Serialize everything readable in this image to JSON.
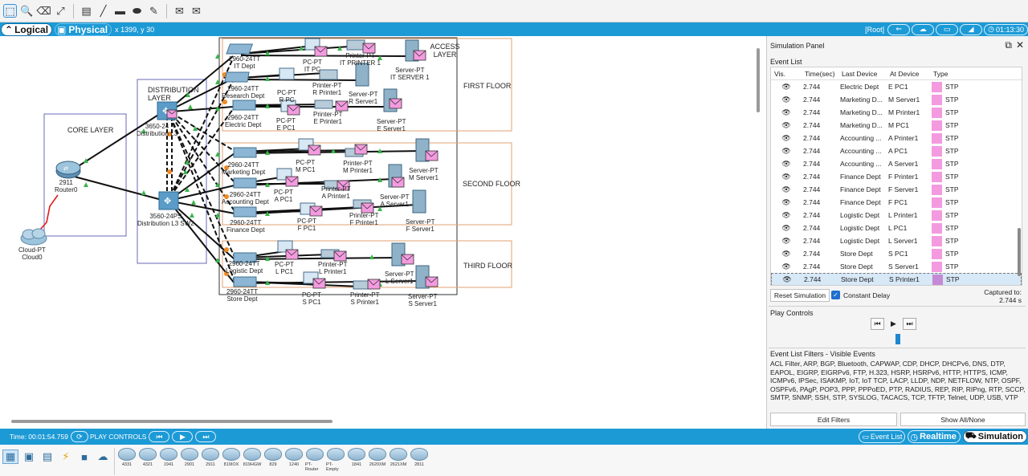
{
  "toolbar": {
    "icons": [
      "select-icon",
      "inspect-icon",
      "delete-icon",
      "resize-icon",
      "note-icon",
      "line-icon",
      "rectangle-icon",
      "ellipse-icon",
      "freeform-icon",
      "simple-pdu-icon",
      "complex-pdu-icon"
    ]
  },
  "topbar": {
    "logical_label": "Logical",
    "physical_label": "Physical",
    "coords": "x 1399, y 30",
    "root_label": "[Root]",
    "clock": "01:13:30"
  },
  "diagram": {
    "regions": {
      "core_layer": "CORE LAYER",
      "distribution_layer": "DISTRIBUTION LAYER",
      "access_layer": "ACCESS LAYER",
      "first_floor": "FIRST FLOOR",
      "second_floor": "SECOND FLOOR",
      "third_floor": "THIRD FLOOR"
    },
    "devices": {
      "cloud_model": "Cloud-PT",
      "cloud_name": "Cloud0",
      "router_model": "2911",
      "router_name": "Router0",
      "dist1_model": "3650-24",
      "dist1_name": "Distribution L3",
      "dist2_model": "3560-24PS",
      "dist2_name": "Distribution L3 SW2",
      "sw_it": "2960-24TT",
      "sw_it_name": "IT Dept",
      "sw_research": "2960-24TT",
      "sw_research_name": "Research Dept",
      "sw_electric": "2960-24TT",
      "sw_electric_name": "Electric Dept",
      "sw_marketing": "2960-24TT",
      "sw_marketing_name": "Marketing Dept",
      "sw_accounting": "2960-24TT",
      "sw_accounting_name": "Accounting Dept",
      "sw_finance": "2960-24TT",
      "sw_finance_name": "Finance Dept",
      "sw_logistic": "2960-24TT",
      "sw_logistic_name": "Logistic Dept",
      "sw_store": "2960-24TT",
      "sw_store_name": "Store Dept",
      "it_pc": "PC-PT",
      "it_pc_name": "IT PC",
      "it_printer": "Printer-PT",
      "it_printer_name": "IT PRINTER 1",
      "it_server": "Server-PT",
      "it_server_name": "IT SERVER 1",
      "r_pc": "PC-PT",
      "r_pc_name": "R PC",
      "r_printer": "Printer-PT",
      "r_printer_name": "R Printer1",
      "r_server": "Server-PT",
      "r_server_name": "R Server1",
      "e_pc": "PC-PT",
      "e_pc_name": "E PC1",
      "e_printer": "Printer-PT",
      "e_printer_name": "E Printer1",
      "e_server": "Server-PT",
      "e_server_name": "E Server1",
      "m_pc": "PC-PT",
      "m_pc_name": "M PC1",
      "m_printer": "Printer-PT",
      "m_printer_name": "M Printer1",
      "m_server": "Server-PT",
      "m_server_name": "M Server1",
      "a_pc": "PC-PT",
      "a_pc_name": "A PC1",
      "a_printer": "Printer-PT",
      "a_printer_name": "A Printer1",
      "a_server": "Server-PT",
      "a_server_name": "A Server1",
      "f_pc": "PC-PT",
      "f_pc_name": "F PC1",
      "f_printer": "Printer-PT",
      "f_printer_name": "F Printer1",
      "f_server": "Server-PT",
      "f_server_name": "F Server1",
      "l_pc": "PC-PT",
      "l_pc_name": "L PC1",
      "l_printer": "Printer-PT",
      "l_printer_name": "L Printer1",
      "l_server": "Server-PT",
      "l_server_name": "L Server1",
      "s_pc": "PC-PT",
      "s_pc_name": "S PC1",
      "s_printer": "Printer-PT",
      "s_printer_name": "S Printer1",
      "s_server": "Server-PT",
      "s_server_name": "S Server1"
    }
  },
  "sim_panel": {
    "title": "Simulation Panel",
    "event_list_label": "Event List",
    "columns": [
      "Vis.",
      "Time(sec)",
      "Last Device",
      "At Device",
      "Type"
    ],
    "events": [
      {
        "time": "2.744",
        "last": "Electric Dept",
        "at": "E PC1",
        "type": "STP"
      },
      {
        "time": "2.744",
        "last": "Marketing D...",
        "at": "M Server1",
        "type": "STP"
      },
      {
        "time": "2.744",
        "last": "Marketing D...",
        "at": "M Printer1",
        "type": "STP"
      },
      {
        "time": "2.744",
        "last": "Marketing D...",
        "at": "M PC1",
        "type": "STP"
      },
      {
        "time": "2.744",
        "last": "Accounting ...",
        "at": "A Printer1",
        "type": "STP"
      },
      {
        "time": "2.744",
        "last": "Accounting ...",
        "at": "A PC1",
        "type": "STP"
      },
      {
        "time": "2.744",
        "last": "Accounting ...",
        "at": "A Server1",
        "type": "STP"
      },
      {
        "time": "2.744",
        "last": "Finance Dept",
        "at": "F Printer1",
        "type": "STP"
      },
      {
        "time": "2.744",
        "last": "Finance Dept",
        "at": "F Server1",
        "type": "STP"
      },
      {
        "time": "2.744",
        "last": "Finance Dept",
        "at": "F PC1",
        "type": "STP"
      },
      {
        "time": "2.744",
        "last": "Logistic Dept",
        "at": "L Printer1",
        "type": "STP"
      },
      {
        "time": "2.744",
        "last": "Logistic Dept",
        "at": "L PC1",
        "type": "STP"
      },
      {
        "time": "2.744",
        "last": "Logistic Dept",
        "at": "L Server1",
        "type": "STP"
      },
      {
        "time": "2.744",
        "last": "Store Dept",
        "at": "S PC1",
        "type": "STP"
      },
      {
        "time": "2.744",
        "last": "Store Dept",
        "at": "S Server1",
        "type": "STP"
      },
      {
        "time": "2.744",
        "last": "Store Dept",
        "at": "S Printer1",
        "type": "STP",
        "selected": true
      }
    ],
    "stp_color": "#f49be0",
    "reset_label": "Reset Simulation",
    "constant_delay_label": "Constant Delay",
    "captured_label": "Captured to:",
    "captured_value": "2.744 s",
    "play_controls_label": "Play Controls",
    "filters_label": "Event List Filters - Visible Events",
    "filters_text": "ACL Filter, ARP, BGP, Bluetooth, CAPWAP, CDP, DHCP, DHCPv6, DNS, DTP, EAPOL, EIGRP, EIGRPv6, FTP, H.323, HSRP, HSRPv6, HTTP, HTTPS, ICMP, ICMPv6, IPSec, ISAKMP, IoT, IoT TCP, LACP, LLDP, NDP, NETFLOW, NTP, OSPF, OSPFv6, PAgP, POP3, PPP, PPPoED, PTP, RADIUS, REP, RIP, RIPng, RTP, SCCP, SMTP, SNMP, SSH, STP, SYSLOG, TACACS, TCP, TFTP, Telnet, UDP, USB, VTP",
    "edit_filters_label": "Edit Filters",
    "show_all_label": "Show All/None"
  },
  "bottombar": {
    "time": "Time: 00:01:54.759",
    "play_controls_label": "PLAY CONTROLS",
    "event_list_label": "Event List",
    "realtime_label": "Realtime",
    "simulation_label": "Simulation"
  },
  "palette": {
    "categories": [
      "network-devices-icon",
      "end-devices-icon",
      "components-icon",
      "connections-icon",
      "misc-icon",
      "multiuser-icon"
    ],
    "models": [
      "4331",
      "4321",
      "1941",
      "2901",
      "2911",
      "819IOX",
      "819HGW",
      "829",
      "1240",
      "PT-Router",
      "PT-Empty",
      "1841",
      "2620XM",
      "2621XM",
      "2811"
    ]
  }
}
